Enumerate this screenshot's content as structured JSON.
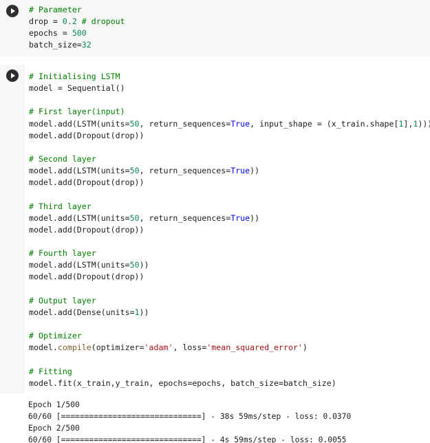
{
  "cells": [
    {
      "run_button_label": "Run cell",
      "lines": [
        [
          {
            "t": "# Parameter",
            "c": "cm"
          }
        ],
        [
          {
            "t": "drop = ",
            "c": ""
          },
          {
            "t": "0.2",
            "c": "num"
          },
          {
            "t": " # dropout",
            "c": "cm"
          }
        ],
        [
          {
            "t": "epochs = ",
            "c": ""
          },
          {
            "t": "500",
            "c": "num"
          }
        ],
        [
          {
            "t": "batch_size=",
            "c": ""
          },
          {
            "t": "32",
            "c": "num"
          }
        ]
      ]
    },
    {
      "run_button_label": "Run cell",
      "lines": [
        [
          {
            "t": "# Initialising LSTM",
            "c": "cm"
          }
        ],
        [
          {
            "t": "model = Sequential()",
            "c": ""
          }
        ],
        [],
        [
          {
            "t": "# First layer(input)",
            "c": "cm"
          }
        ],
        [
          {
            "t": "model.add(LSTM(units=",
            "c": ""
          },
          {
            "t": "50",
            "c": "num"
          },
          {
            "t": ", return_sequences=",
            "c": ""
          },
          {
            "t": "True",
            "c": "kw"
          },
          {
            "t": ", input_shape = (x_train.shape[",
            "c": ""
          },
          {
            "t": "1",
            "c": "num"
          },
          {
            "t": "],",
            "c": ""
          },
          {
            "t": "1",
            "c": "num"
          },
          {
            "t": ")))",
            "c": ""
          }
        ],
        [
          {
            "t": "model.add(Dropout(drop))",
            "c": ""
          }
        ],
        [],
        [
          {
            "t": "# Second layer",
            "c": "cm"
          }
        ],
        [
          {
            "t": "model.add(LSTM(units=",
            "c": ""
          },
          {
            "t": "50",
            "c": "num"
          },
          {
            "t": ", return_sequences=",
            "c": ""
          },
          {
            "t": "True",
            "c": "kw"
          },
          {
            "t": "))",
            "c": ""
          }
        ],
        [
          {
            "t": "model.add(Dropout(drop))",
            "c": ""
          }
        ],
        [],
        [
          {
            "t": "# Third layer",
            "c": "cm"
          }
        ],
        [
          {
            "t": "model.add(LSTM(units=",
            "c": ""
          },
          {
            "t": "50",
            "c": "num"
          },
          {
            "t": ", return_sequences=",
            "c": ""
          },
          {
            "t": "True",
            "c": "kw"
          },
          {
            "t": "))",
            "c": ""
          }
        ],
        [
          {
            "t": "model.add(Dropout(drop))",
            "c": ""
          }
        ],
        [],
        [
          {
            "t": "# Fourth layer",
            "c": "cm"
          }
        ],
        [
          {
            "t": "model.add(LSTM(units=",
            "c": ""
          },
          {
            "t": "50",
            "c": "num"
          },
          {
            "t": "))",
            "c": ""
          }
        ],
        [
          {
            "t": "model.add(Dropout(drop))",
            "c": ""
          }
        ],
        [],
        [
          {
            "t": "# Output layer",
            "c": "cm"
          }
        ],
        [
          {
            "t": "model.add(Dense(units=",
            "c": ""
          },
          {
            "t": "1",
            "c": "num"
          },
          {
            "t": "))",
            "c": ""
          }
        ],
        [],
        [
          {
            "t": "# Optimizer",
            "c": "cm"
          }
        ],
        [
          {
            "t": "model.",
            "c": ""
          },
          {
            "t": "compile",
            "c": "fn"
          },
          {
            "t": "(optimizer=",
            "c": ""
          },
          {
            "t": "'adam'",
            "c": "str"
          },
          {
            "t": ", loss=",
            "c": ""
          },
          {
            "t": "'mean_squared_error'",
            "c": "str"
          },
          {
            "t": ")",
            "c": ""
          }
        ],
        [],
        [
          {
            "t": "# Fitting",
            "c": "cm"
          }
        ],
        [
          {
            "t": "model.fit(x_train,y_train, epochs=epochs, batch_size=batch_size)",
            "c": ""
          }
        ]
      ]
    }
  ],
  "output": {
    "lines": [
      "Epoch 1/500",
      "60/60 [==============================] - 38s 59ms/step - loss: 0.0370",
      "Epoch 2/500",
      "60/60 [==============================] - 4s 59ms/step - loss: 0.0055"
    ]
  }
}
